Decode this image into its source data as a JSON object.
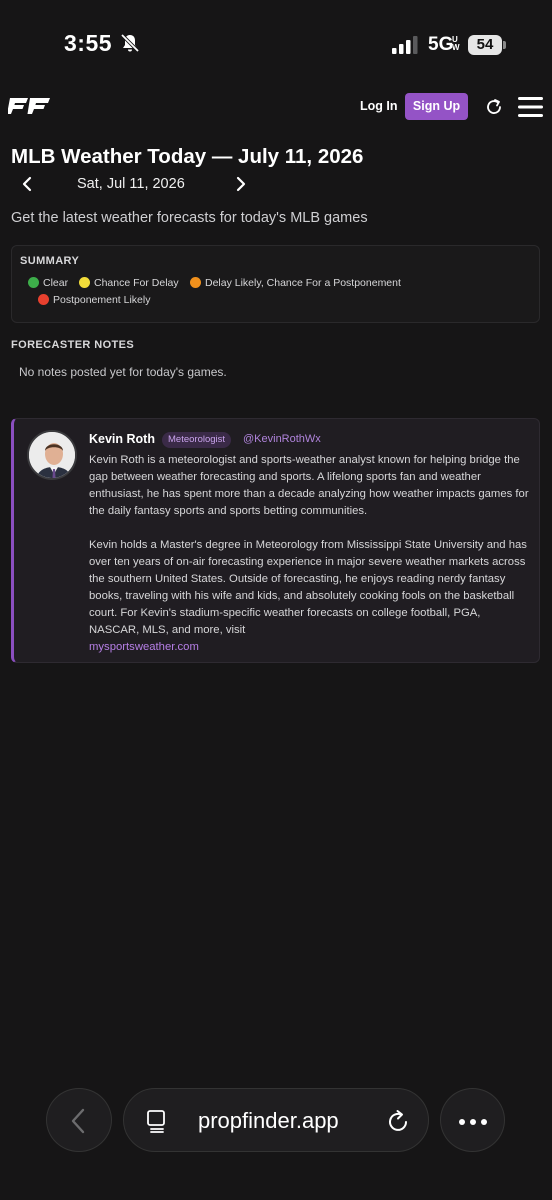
{
  "status_bar": {
    "time": "3:55",
    "network": "5G",
    "network_sub": "UW",
    "battery": "54",
    "icons": [
      "bell-slash-icon",
      "signal-icon",
      "battery-icon"
    ]
  },
  "nav": {
    "logo": "PF",
    "login_label": "Log In",
    "signup_label": "Sign Up",
    "accent": "#9453c6"
  },
  "header": {
    "title": "MLB Weather Today — July 11, 2026",
    "date": "Sat, Jul 11, 2026",
    "subtitle": "Get the latest weather forecasts for today's MLB games"
  },
  "summary": {
    "title": "SUMMARY",
    "legend": [
      {
        "label": "Clear",
        "color": "#3dae4a"
      },
      {
        "label": "Chance For Delay",
        "color": "#f2dc3a"
      },
      {
        "label": "Delay Likely, Chance For a Postponement",
        "color": "#f0901c"
      },
      {
        "label": "Postponement Likely",
        "color": "#e8402e"
      }
    ]
  },
  "forecaster_notes": {
    "title": "FORECASTER NOTES",
    "text": "No notes posted yet for today's games."
  },
  "author": {
    "name": "Kevin Roth",
    "role": "Meteorologist",
    "handle": "@KevinRothWx",
    "bio_1": "Kevin Roth is a meteorologist and sports-weather analyst known for helping bridge the gap between weather forecasting and sports. A lifelong sports fan and weather enthusiast, he has spent more than a decade analyzing how weather impacts games for the daily fantasy sports and sports betting communities.",
    "bio_2": "Kevin holds a Master's degree in Meteorology from Mississippi State University and has over ten years of on-air forecasting experience in major severe weather markets across the southern United States. Outside of forecasting, he enjoys reading nerdy fantasy books, traveling with his wife and kids, and absolutely cooking fools on the basketball court. For Kevin's stadium-specific weather forecasts on college football, PGA, NASCAR, MLS, and more, visit",
    "link": "mysportsweather.com"
  },
  "browser": {
    "url": "propfinder.app"
  }
}
